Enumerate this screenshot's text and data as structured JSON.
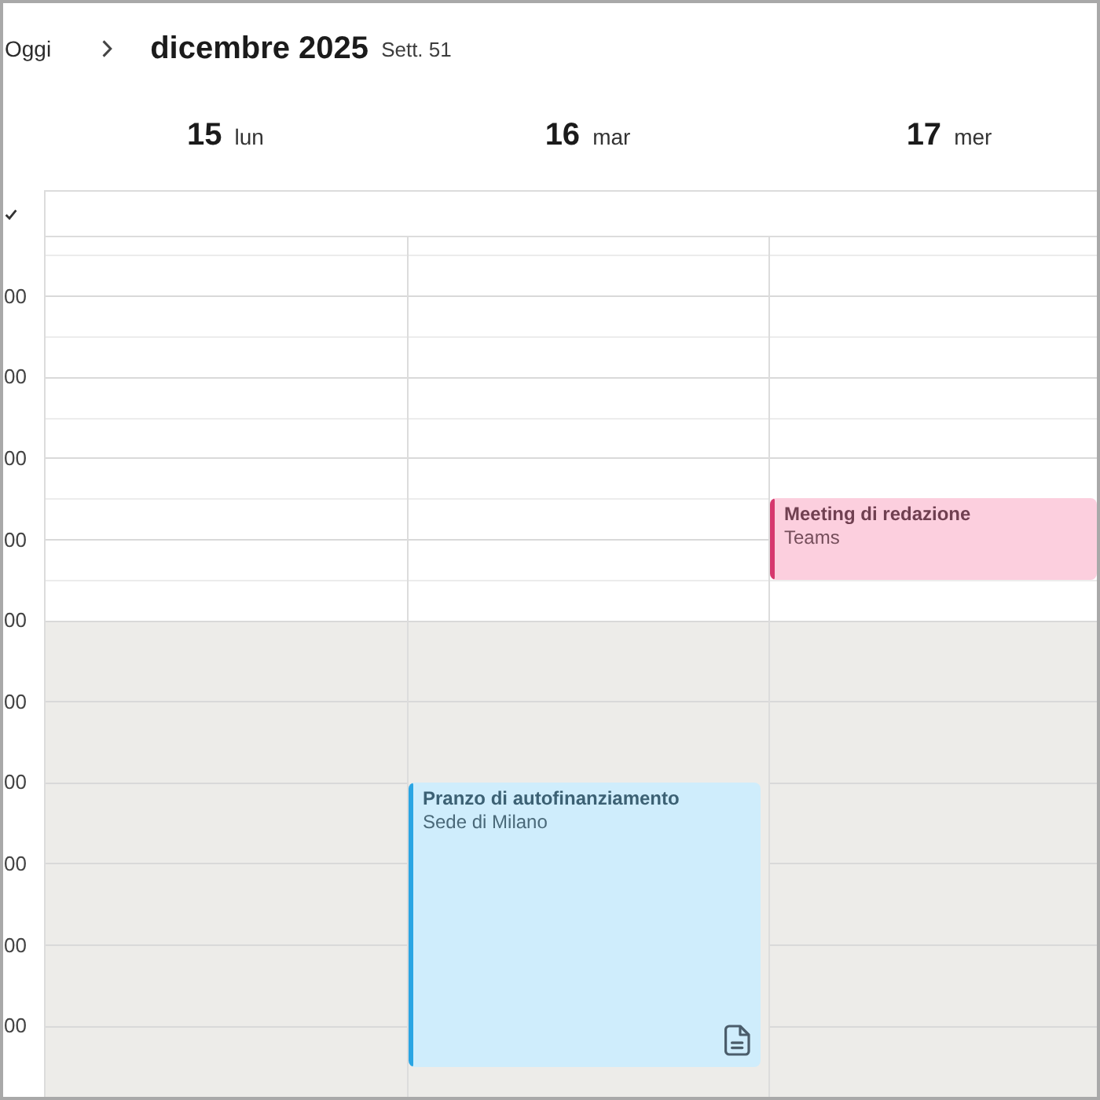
{
  "toolbar": {
    "today_button": "Oggi",
    "title": "dicembre 2025",
    "week": "Sett. 51"
  },
  "days": [
    {
      "number": "15",
      "weekday": "lun"
    },
    {
      "number": "16",
      "weekday": "mar",
      "events": [
        {
          "title": "Pranzo di autofinanziamento",
          "location": "Sede di Milano",
          "color": "#2aa5e3",
          "attachment": true
        }
      ]
    },
    {
      "number": "17",
      "weekday": "mer",
      "events": [
        {
          "title": "Meeting di redazione",
          "location": "Teams",
          "color": "#d6386e",
          "attachment": false
        }
      ]
    }
  ],
  "hours": [
    {
      "label": "00",
      "working": true
    },
    {
      "label": "00",
      "working": true
    },
    {
      "label": "00",
      "working": true
    },
    {
      "label": "00",
      "working": true
    },
    {
      "label": "00",
      "working": false
    },
    {
      "label": "00",
      "working": false
    },
    {
      "label": "00",
      "working": false
    },
    {
      "label": "00",
      "working": false
    },
    {
      "label": "00",
      "working": false
    },
    {
      "label": "00",
      "working": false
    }
  ]
}
